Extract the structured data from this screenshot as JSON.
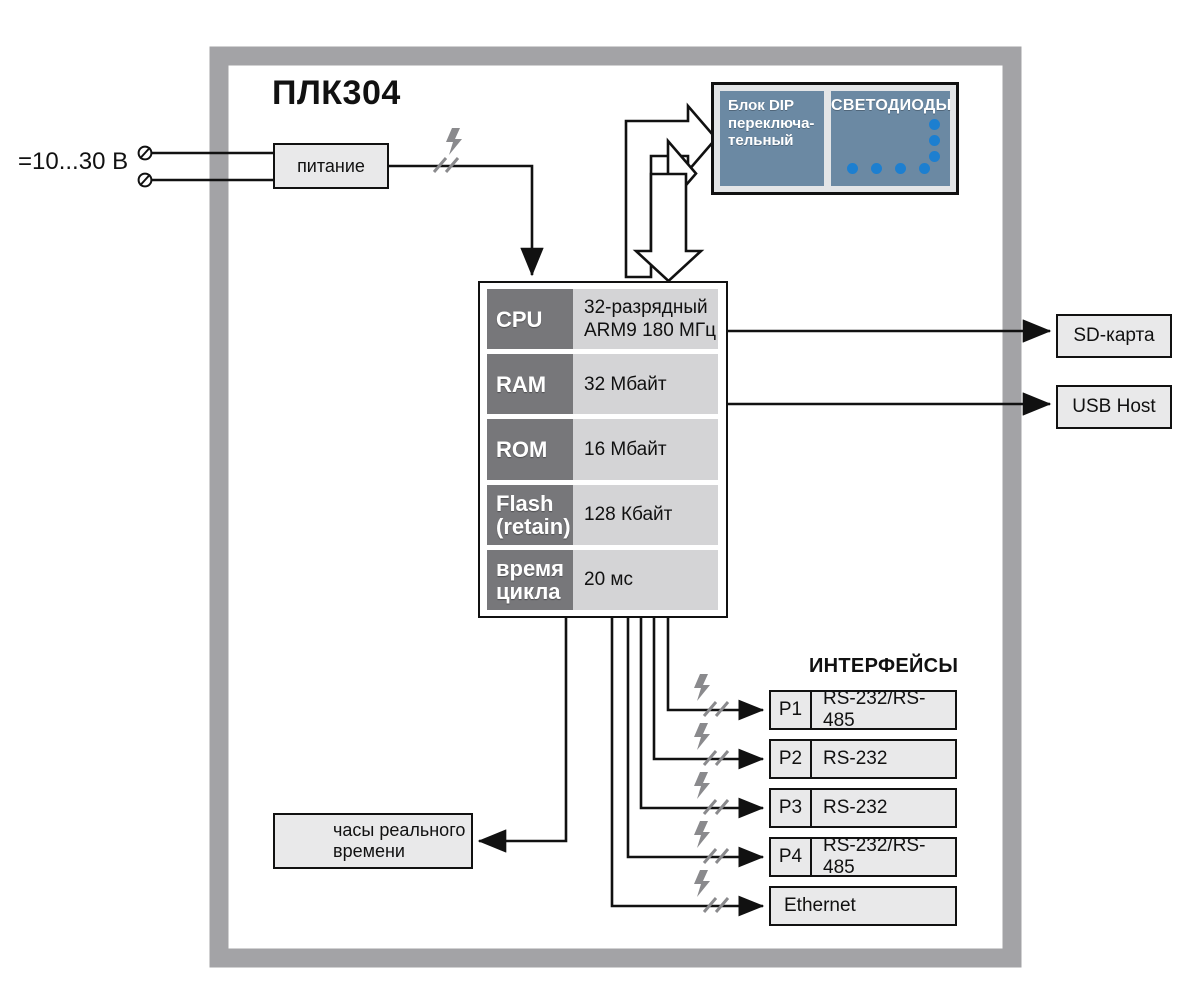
{
  "diagram": {
    "title": "ПЛК304",
    "power_input_label": "=10...30 В",
    "power_block_label": "питание"
  },
  "io_panel": {
    "dip_block_label": "Блок DIP переключа-тельный",
    "dip_block_lines": [
      "Блок DIP",
      "переключа-",
      "тельный"
    ],
    "led_block_label": "СВЕТОДИОДЫ",
    "led_color": "#1d7fd0",
    "panel_color": "#6b89a3",
    "led_dots_vertical": 3,
    "led_dots_horizontal": 4
  },
  "cpu_block": {
    "rows": [
      {
        "key": "CPU",
        "value": "32-разрядный\nARM9  180 МГц",
        "value_lines": [
          "32-разрядный",
          "ARM9  180 МГц"
        ]
      },
      {
        "key": "RAM",
        "value": "32 Мбайт",
        "value_lines": [
          "32 Мбайт"
        ]
      },
      {
        "key": "ROM",
        "value": "16 Мбайт",
        "value_lines": [
          "16 Мбайт"
        ]
      },
      {
        "key": "Flash\n(retain)",
        "key_lines": [
          "Flash",
          "(retain)"
        ],
        "value": "128 Кбайт",
        "value_lines": [
          "128 Кбайт"
        ]
      },
      {
        "key": "время\nцикла",
        "key_lines": [
          "время",
          "цикла"
        ],
        "value": "20 мс",
        "value_lines": [
          "20 мс"
        ]
      }
    ],
    "key_bg": "#77777a",
    "value_bg": "#d4d4d6"
  },
  "peripherals": [
    {
      "label": "SD-карта"
    },
    {
      "label": "USB Host"
    }
  ],
  "interfaces": {
    "title": "ИНТЕРФЕЙСЫ",
    "items": [
      {
        "port": "P1",
        "name": "RS-232/RS-485"
      },
      {
        "port": "P2",
        "name": "RS-232"
      },
      {
        "port": "P3",
        "name": "RS-232"
      },
      {
        "port": "P4",
        "name": "RS-232/RS-485"
      },
      {
        "port": "",
        "name": "Ethernet"
      }
    ]
  },
  "rtc": {
    "label": "часы реального времени",
    "lines": [
      "часы реального",
      "времени"
    ]
  },
  "colors": {
    "frame_gray": "#a3a3a6",
    "box_fill": "#e9e9ea",
    "outline": "#111111",
    "isolation_symbol": "#8a8a8d"
  }
}
